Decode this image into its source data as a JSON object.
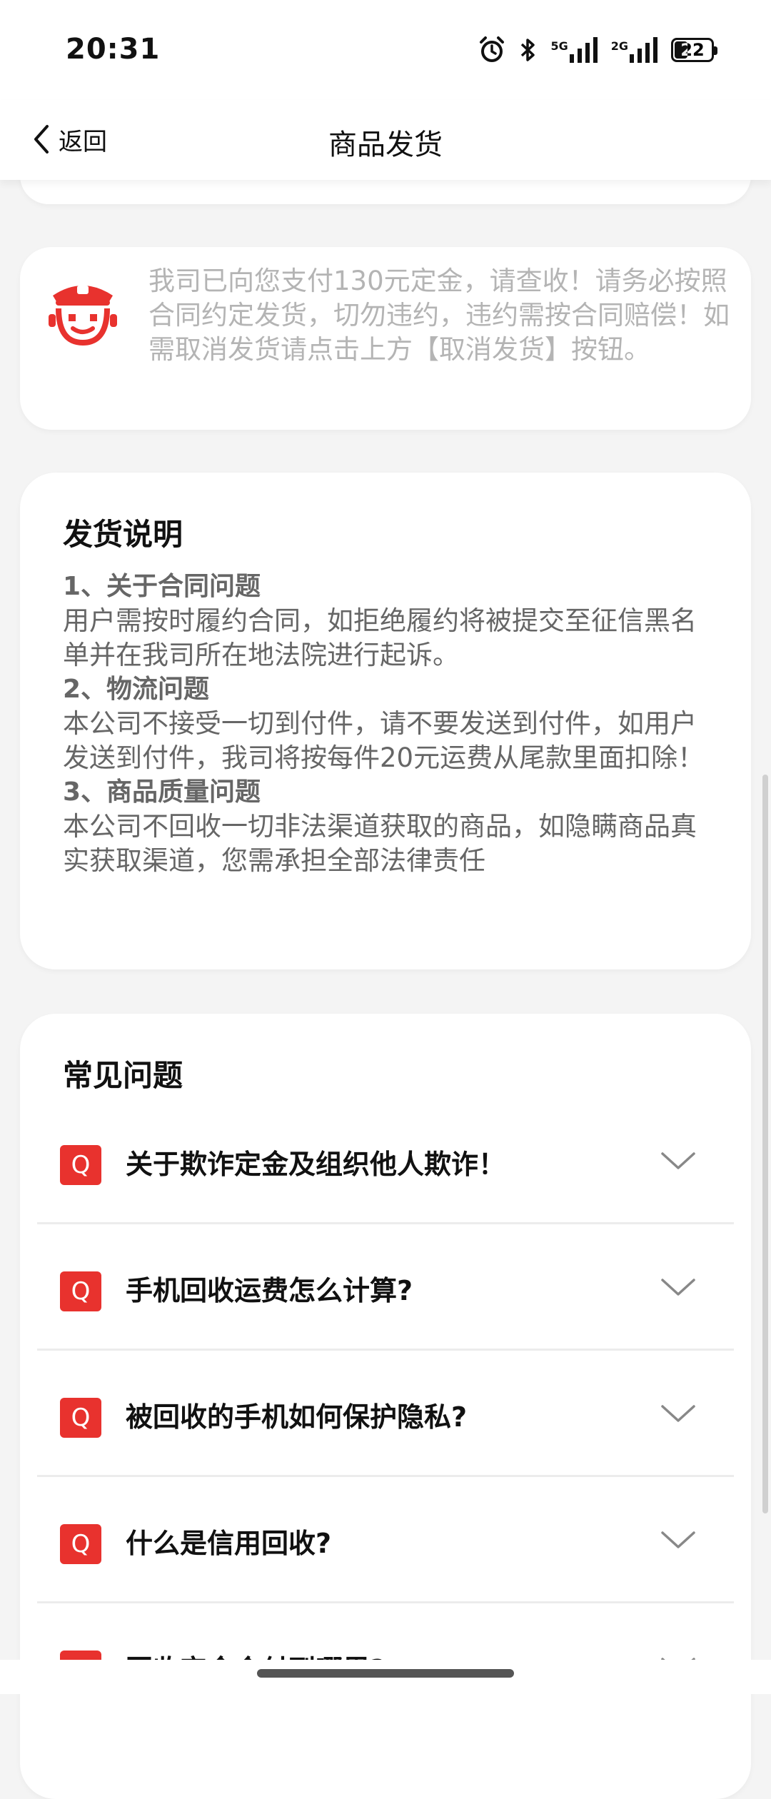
{
  "status_bar": {
    "time": "20:31",
    "network1": "5G",
    "network2": "2G",
    "battery": "22"
  },
  "nav": {
    "back_label": "返回",
    "title": "商品发货"
  },
  "notice": {
    "text": "我司已向您支付130元定金，请查收！请务必按照合同约定发货，切勿违约，违约需按合同赔偿！如需取消发货请点击上方【取消发货】按钮。"
  },
  "shipping": {
    "title": "发货说明",
    "rules": [
      {
        "title": "1、关于合同问题",
        "body": "用户需按时履约合同，如拒绝履约将被提交至征信黑名单并在我司所在地法院进行起诉。"
      },
      {
        "title": "2、物流问题",
        "body": "本公司不接受一切到付件，请不要发送到付件，如用户发送到付件，我司将按每件20元运费从尾款里面扣除！"
      },
      {
        "title": "3、商品质量问题",
        "body": "本公司不回收一切非法渠道获取的商品，如隐瞒商品真实获取渠道，您需承担全部法律责任"
      }
    ]
  },
  "faq": {
    "title": "常见问题",
    "badge": "Q",
    "items": [
      {
        "question": "关于欺诈定金及组织他人欺诈！"
      },
      {
        "question": "手机回收运费怎么计算?"
      },
      {
        "question": "被回收的手机如何保护隐私?"
      },
      {
        "question": "什么是信用回收?"
      },
      {
        "question": "回收定金会付到哪里?"
      }
    ]
  },
  "colors": {
    "accent_red": "#e8322e",
    "muted_text": "#b4b4b4",
    "body_text": "#666666"
  }
}
